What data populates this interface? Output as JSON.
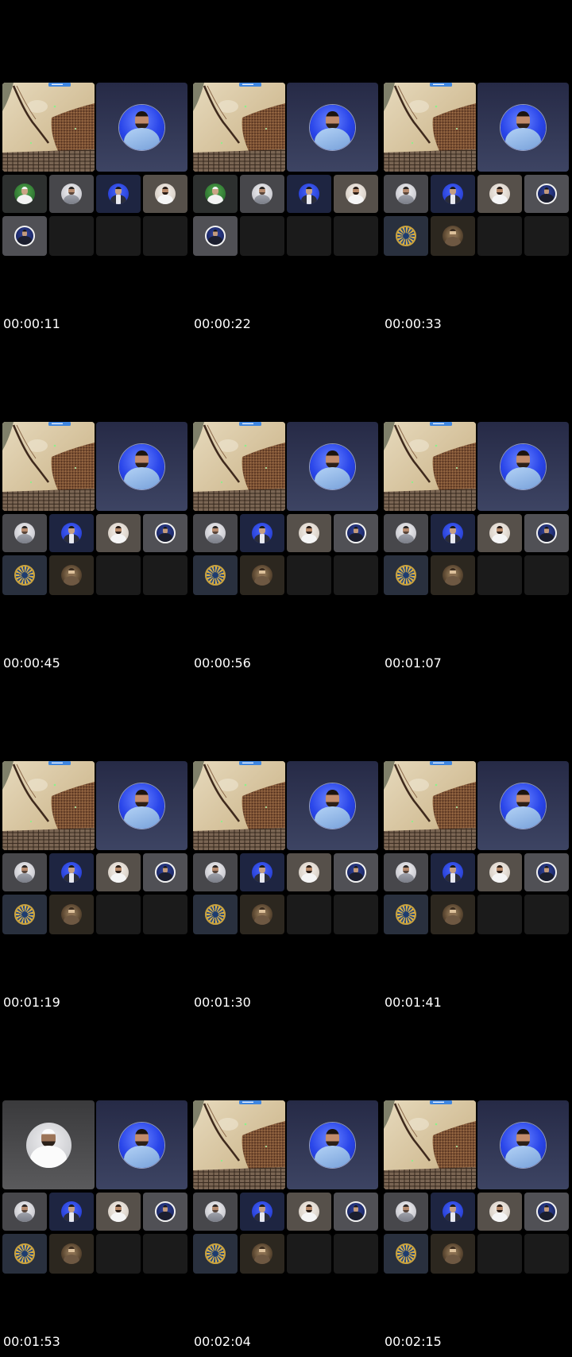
{
  "frames": [
    {
      "timestamp": "00:00:11",
      "main": [
        "map-screen-share",
        "host-avatar"
      ],
      "grid": [
        "green-avatar",
        "grey-man-avatar",
        "blue-man-avatar",
        "bearded-man-avatar",
        "navy-ring-avatar",
        "empty-tile",
        "empty-tile",
        "empty-tile"
      ]
    },
    {
      "timestamp": "00:00:22",
      "main": [
        "map-screen-share",
        "host-avatar"
      ],
      "grid": [
        "green-avatar",
        "grey-man-avatar",
        "blue-man-avatar",
        "bearded-man-avatar",
        "navy-ring-avatar",
        "empty-tile",
        "empty-tile",
        "empty-tile"
      ]
    },
    {
      "timestamp": "00:00:33",
      "main": [
        "map-screen-share",
        "host-avatar"
      ],
      "grid": [
        "grey-man-avatar",
        "blue-man-avatar",
        "bearded-man-avatar",
        "navy-ring-avatar",
        "gold-emblem-avatar",
        "sepia-man-avatar",
        "empty-tile",
        "empty-tile"
      ]
    },
    {
      "timestamp": "00:00:45",
      "main": [
        "map-screen-share",
        "host-avatar"
      ],
      "grid": [
        "grey-man-avatar",
        "blue-man-avatar",
        "bearded-man-avatar",
        "navy-ring-avatar",
        "gold-emblem-avatar",
        "sepia-man-avatar",
        "empty-tile",
        "empty-tile"
      ]
    },
    {
      "timestamp": "00:00:56",
      "main": [
        "map-screen-share",
        "host-avatar"
      ],
      "grid": [
        "grey-man-avatar",
        "blue-man-avatar",
        "bearded-man-avatar",
        "navy-ring-avatar",
        "gold-emblem-avatar",
        "sepia-man-avatar",
        "empty-tile",
        "empty-tile"
      ]
    },
    {
      "timestamp": "00:01:07",
      "main": [
        "map-screen-share",
        "host-avatar"
      ],
      "grid": [
        "grey-man-avatar",
        "blue-man-avatar",
        "bearded-man-avatar",
        "navy-ring-avatar",
        "gold-emblem-avatar",
        "sepia-man-avatar",
        "empty-tile",
        "empty-tile"
      ]
    },
    {
      "timestamp": "00:01:19",
      "main": [
        "map-screen-share",
        "host-avatar"
      ],
      "grid": [
        "grey-man-avatar",
        "blue-man-avatar",
        "bearded-man-avatar",
        "navy-ring-avatar",
        "gold-emblem-avatar",
        "sepia-man-avatar",
        "empty-tile",
        "empty-tile"
      ]
    },
    {
      "timestamp": "00:01:30",
      "main": [
        "map-screen-share",
        "host-avatar"
      ],
      "grid": [
        "grey-man-avatar",
        "blue-man-avatar",
        "bearded-man-avatar",
        "navy-ring-avatar",
        "gold-emblem-avatar",
        "sepia-man-avatar",
        "empty-tile",
        "empty-tile"
      ]
    },
    {
      "timestamp": "00:01:41",
      "main": [
        "map-screen-share",
        "host-avatar"
      ],
      "grid": [
        "grey-man-avatar",
        "blue-man-avatar",
        "bearded-man-avatar",
        "navy-ring-avatar",
        "gold-emblem-avatar",
        "sepia-man-avatar",
        "empty-tile",
        "empty-tile"
      ]
    },
    {
      "timestamp": "00:01:53",
      "main": [
        "white-robe-man-avatar",
        "host-avatar"
      ],
      "grid": [
        "grey-man-avatar",
        "blue-man-avatar",
        "bearded-man-avatar",
        "navy-ring-avatar",
        "gold-emblem-avatar",
        "sepia-man-avatar",
        "empty-tile",
        "empty-tile"
      ]
    },
    {
      "timestamp": "00:02:04",
      "main": [
        "map-screen-share",
        "host-avatar"
      ],
      "grid": [
        "grey-man-avatar",
        "blue-man-avatar",
        "bearded-man-avatar",
        "navy-ring-avatar",
        "gold-emblem-avatar",
        "sepia-man-avatar",
        "empty-tile",
        "empty-tile"
      ]
    },
    {
      "timestamp": "00:02:15",
      "main": [
        "map-screen-share",
        "host-avatar"
      ],
      "grid": [
        "grey-man-avatar",
        "blue-man-avatar",
        "bearded-man-avatar",
        "navy-ring-avatar",
        "gold-emblem-avatar",
        "sepia-man-avatar",
        "empty-tile",
        "empty-tile"
      ]
    }
  ]
}
